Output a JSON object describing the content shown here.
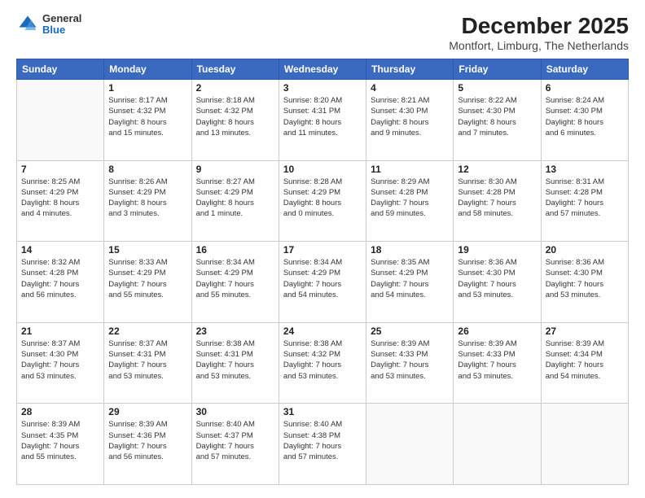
{
  "logo": {
    "general": "General",
    "blue": "Blue"
  },
  "header": {
    "title": "December 2025",
    "subtitle": "Montfort, Limburg, The Netherlands"
  },
  "columns": [
    "Sunday",
    "Monday",
    "Tuesday",
    "Wednesday",
    "Thursday",
    "Friday",
    "Saturday"
  ],
  "weeks": [
    [
      {
        "day": "",
        "info": ""
      },
      {
        "day": "1",
        "info": "Sunrise: 8:17 AM\nSunset: 4:32 PM\nDaylight: 8 hours\nand 15 minutes."
      },
      {
        "day": "2",
        "info": "Sunrise: 8:18 AM\nSunset: 4:32 PM\nDaylight: 8 hours\nand 13 minutes."
      },
      {
        "day": "3",
        "info": "Sunrise: 8:20 AM\nSunset: 4:31 PM\nDaylight: 8 hours\nand 11 minutes."
      },
      {
        "day": "4",
        "info": "Sunrise: 8:21 AM\nSunset: 4:30 PM\nDaylight: 8 hours\nand 9 minutes."
      },
      {
        "day": "5",
        "info": "Sunrise: 8:22 AM\nSunset: 4:30 PM\nDaylight: 8 hours\nand 7 minutes."
      },
      {
        "day": "6",
        "info": "Sunrise: 8:24 AM\nSunset: 4:30 PM\nDaylight: 8 hours\nand 6 minutes."
      }
    ],
    [
      {
        "day": "7",
        "info": "Sunrise: 8:25 AM\nSunset: 4:29 PM\nDaylight: 8 hours\nand 4 minutes."
      },
      {
        "day": "8",
        "info": "Sunrise: 8:26 AM\nSunset: 4:29 PM\nDaylight: 8 hours\nand 3 minutes."
      },
      {
        "day": "9",
        "info": "Sunrise: 8:27 AM\nSunset: 4:29 PM\nDaylight: 8 hours\nand 1 minute."
      },
      {
        "day": "10",
        "info": "Sunrise: 8:28 AM\nSunset: 4:29 PM\nDaylight: 8 hours\nand 0 minutes."
      },
      {
        "day": "11",
        "info": "Sunrise: 8:29 AM\nSunset: 4:28 PM\nDaylight: 7 hours\nand 59 minutes."
      },
      {
        "day": "12",
        "info": "Sunrise: 8:30 AM\nSunset: 4:28 PM\nDaylight: 7 hours\nand 58 minutes."
      },
      {
        "day": "13",
        "info": "Sunrise: 8:31 AM\nSunset: 4:28 PM\nDaylight: 7 hours\nand 57 minutes."
      }
    ],
    [
      {
        "day": "14",
        "info": "Sunrise: 8:32 AM\nSunset: 4:28 PM\nDaylight: 7 hours\nand 56 minutes."
      },
      {
        "day": "15",
        "info": "Sunrise: 8:33 AM\nSunset: 4:29 PM\nDaylight: 7 hours\nand 55 minutes."
      },
      {
        "day": "16",
        "info": "Sunrise: 8:34 AM\nSunset: 4:29 PM\nDaylight: 7 hours\nand 55 minutes."
      },
      {
        "day": "17",
        "info": "Sunrise: 8:34 AM\nSunset: 4:29 PM\nDaylight: 7 hours\nand 54 minutes."
      },
      {
        "day": "18",
        "info": "Sunrise: 8:35 AM\nSunset: 4:29 PM\nDaylight: 7 hours\nand 54 minutes."
      },
      {
        "day": "19",
        "info": "Sunrise: 8:36 AM\nSunset: 4:30 PM\nDaylight: 7 hours\nand 53 minutes."
      },
      {
        "day": "20",
        "info": "Sunrise: 8:36 AM\nSunset: 4:30 PM\nDaylight: 7 hours\nand 53 minutes."
      }
    ],
    [
      {
        "day": "21",
        "info": "Sunrise: 8:37 AM\nSunset: 4:30 PM\nDaylight: 7 hours\nand 53 minutes."
      },
      {
        "day": "22",
        "info": "Sunrise: 8:37 AM\nSunset: 4:31 PM\nDaylight: 7 hours\nand 53 minutes."
      },
      {
        "day": "23",
        "info": "Sunrise: 8:38 AM\nSunset: 4:31 PM\nDaylight: 7 hours\nand 53 minutes."
      },
      {
        "day": "24",
        "info": "Sunrise: 8:38 AM\nSunset: 4:32 PM\nDaylight: 7 hours\nand 53 minutes."
      },
      {
        "day": "25",
        "info": "Sunrise: 8:39 AM\nSunset: 4:33 PM\nDaylight: 7 hours\nand 53 minutes."
      },
      {
        "day": "26",
        "info": "Sunrise: 8:39 AM\nSunset: 4:33 PM\nDaylight: 7 hours\nand 53 minutes."
      },
      {
        "day": "27",
        "info": "Sunrise: 8:39 AM\nSunset: 4:34 PM\nDaylight: 7 hours\nand 54 minutes."
      }
    ],
    [
      {
        "day": "28",
        "info": "Sunrise: 8:39 AM\nSunset: 4:35 PM\nDaylight: 7 hours\nand 55 minutes."
      },
      {
        "day": "29",
        "info": "Sunrise: 8:39 AM\nSunset: 4:36 PM\nDaylight: 7 hours\nand 56 minutes."
      },
      {
        "day": "30",
        "info": "Sunrise: 8:40 AM\nSunset: 4:37 PM\nDaylight: 7 hours\nand 57 minutes."
      },
      {
        "day": "31",
        "info": "Sunrise: 8:40 AM\nSunset: 4:38 PM\nDaylight: 7 hours\nand 57 minutes."
      },
      {
        "day": "",
        "info": ""
      },
      {
        "day": "",
        "info": ""
      },
      {
        "day": "",
        "info": ""
      }
    ]
  ]
}
